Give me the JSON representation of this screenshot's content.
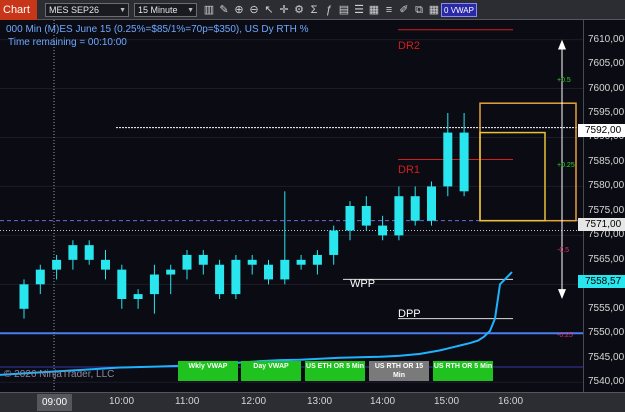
{
  "toolbar": {
    "tab": "Chart",
    "instrument": "MES SEP26",
    "interval": "15 Minute",
    "vwap_label": "0 VWAP",
    "icons": [
      "bars-icon",
      "pencil-icon",
      "magnifier-plus-icon",
      "magnifier-minus-icon",
      "pointer-icon",
      "crosshair-icon",
      "settings-icon",
      "strategy-icon",
      "indicator-icon",
      "template-icon",
      "properties-icon",
      "calendar-icon",
      "list-icon",
      "drawing-tools-icon",
      "copy-icon",
      "grid-icon"
    ]
  },
  "chart": {
    "info_line1": "000 Min (M)ES June 15  (0.25%=$85/1%=70p=$350), US Dy RTH %",
    "info_line2": "Time remaining = 00:10:00",
    "copyright": "© 2026 NinjaTrader, LLC",
    "labels": {
      "dr2": "DR2",
      "dr1": "DR1",
      "wpp": "WPP",
      "dpp": "DPP",
      "pct_up": "+0.25",
      "pct_up2": "+0.5",
      "pct_dn": "-0.25",
      "pct_dn2": "-0.5"
    },
    "vwap_buttons": [
      {
        "label": "Wkly VWAP",
        "style": "green"
      },
      {
        "label": "Day VWAP",
        "style": "green"
      },
      {
        "label": "US ETH OR 5 Min",
        "style": "green"
      },
      {
        "label": "US RTH OR 15 Min",
        "style": "gray"
      },
      {
        "label": "US RTH OR 5 Min",
        "style": "green"
      }
    ],
    "colors": {
      "bull": "#29e6ee",
      "bear": "#29e6ee",
      "vwap": "#1fb3ff",
      "box": "#e8c23a",
      "dr": "#d21e1e",
      "level": "#4a7df0"
    }
  },
  "price_axis": {
    "ticks": [
      "7610,00",
      "7605,00",
      "7600,00",
      "7595,00",
      "7590,00",
      "7585,00",
      "7580,00",
      "7575,00",
      "7570,00",
      "7565,00",
      "7560,00",
      "7555,00",
      "7550,00",
      "7545,00",
      "7540,00"
    ],
    "last_price": "7592,00",
    "level1": "7571,00",
    "level2": "7558,57"
  },
  "time_axis": {
    "cursor": "09:00",
    "ticks": [
      "10:00",
      "11:00",
      "12:00",
      "13:00",
      "14:00",
      "15:00",
      "16:00"
    ]
  },
  "chart_data": {
    "type": "candlestick",
    "categories": [
      "09:00",
      "09:15",
      "09:30",
      "09:45",
      "10:00",
      "10:15",
      "10:30",
      "10:45",
      "11:00",
      "11:15",
      "11:30",
      "11:45",
      "12:00",
      "12:15",
      "12:30",
      "12:45",
      "13:00",
      "13:15",
      "13:30",
      "13:45",
      "14:00",
      "14:15",
      "14:30",
      "14:45",
      "15:00",
      "15:15",
      "15:30",
      "15:45"
    ],
    "ohlc": [
      [
        7555,
        7561,
        7553,
        7560
      ],
      [
        7560,
        7564,
        7558,
        7563
      ],
      [
        7563,
        7566,
        7561,
        7565
      ],
      [
        7565,
        7569,
        7563,
        7568
      ],
      [
        7568,
        7569,
        7564,
        7565
      ],
      [
        7565,
        7567,
        7561,
        7563
      ],
      [
        7563,
        7564,
        7555,
        7557
      ],
      [
        7557,
        7559,
        7555,
        7558
      ],
      [
        7558,
        7564,
        7554,
        7562
      ],
      [
        7562,
        7564,
        7558,
        7563
      ],
      [
        7563,
        7567,
        7561,
        7566
      ],
      [
        7566,
        7567,
        7562,
        7564
      ],
      [
        7564,
        7565,
        7557,
        7558
      ],
      [
        7558,
        7566,
        7557,
        7565
      ],
      [
        7565,
        7566,
        7562,
        7564
      ],
      [
        7564,
        7565,
        7560,
        7561
      ],
      [
        7561,
        7579,
        7560,
        7565
      ],
      [
        7565,
        7566,
        7563,
        7564
      ],
      [
        7564,
        7567,
        7562,
        7566
      ],
      [
        7566,
        7572,
        7564,
        7571
      ],
      [
        7571,
        7577,
        7569,
        7576
      ],
      [
        7576,
        7578,
        7571,
        7572
      ],
      [
        7572,
        7574,
        7569,
        7570
      ],
      [
        7570,
        7580,
        7569,
        7578
      ],
      [
        7578,
        7580,
        7572,
        7573
      ],
      [
        7573,
        7581,
        7572,
        7580
      ],
      [
        7580,
        7595,
        7578,
        7591
      ],
      [
        7591,
        7595,
        7578,
        7579
      ]
    ],
    "vwap": [
      7541.5,
      7542,
      7542.5,
      7543,
      7543.2,
      7543.5,
      7544,
      7544.3,
      7544.5,
      7544.6,
      7544.8,
      7545,
      7545.1,
      7545.2,
      7545.4,
      7545.8,
      7546.5,
      7547,
      7547.5,
      7548,
      7548.5,
      7549.3,
      7550.5,
      7553,
      7560,
      7562.5
    ],
    "levels": {
      "dr2": 7612,
      "dr1": 7585.5,
      "wpp": 7561,
      "dpp": 7553,
      "last": 7592,
      "level1": 7571,
      "level2": 7558.57,
      "dashed": 7573,
      "blue": 7550
    },
    "ylim": [
      7538,
      7614
    ]
  }
}
